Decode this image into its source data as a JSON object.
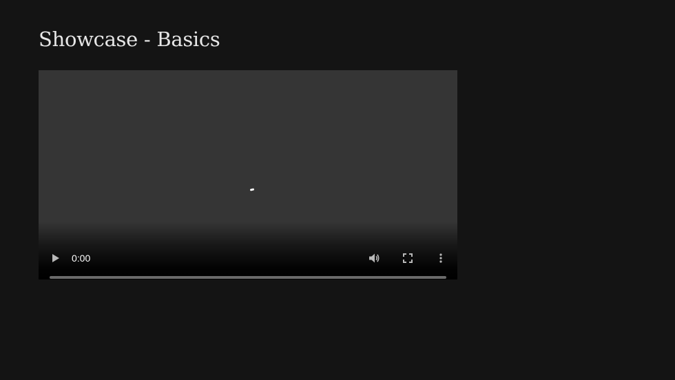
{
  "page": {
    "title": "Showcase - Basics"
  },
  "player": {
    "state": "loading",
    "current_time": "0:00",
    "progress": 0,
    "icons": {
      "play": "play-icon",
      "volume": "volume-icon",
      "fullscreen": "fullscreen-icon",
      "more": "more-vertical-icon",
      "loading": "loading-spinner-icon"
    }
  },
  "colors": {
    "page_background": "#141414",
    "player_background": "#353535",
    "control_icon": "#b9b9b9",
    "title_text": "#e6e6e6"
  }
}
